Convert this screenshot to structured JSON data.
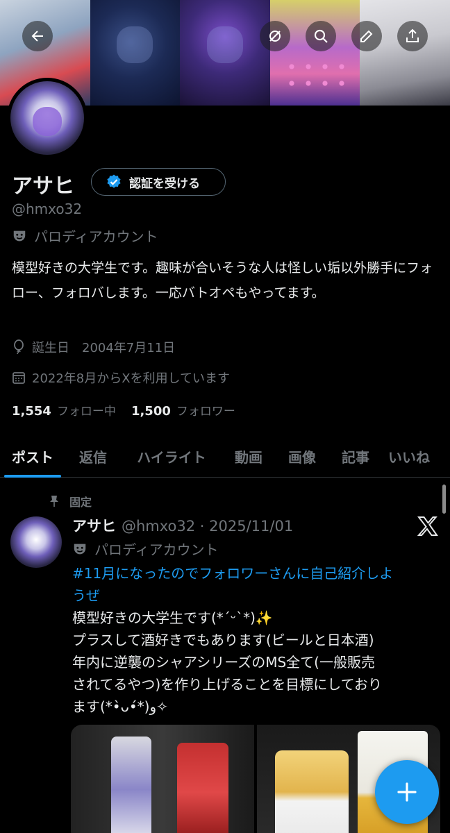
{
  "profile": {
    "name": "アサヒ",
    "verify_label": "認証を受ける",
    "handle": "@hmxo32",
    "parody_label": "パロディアカウント",
    "bio": "模型好きの大学生です。趣味が合いそうな人は怪しい垢以外勝手にフォロー、フォロバします。一応バトオペもやってます。",
    "birthday_label": "誕生日　2004年7月11日",
    "joined_label": "2022年8月からXを利用しています",
    "following_count": "1,554",
    "following_label": "フォロー中",
    "followers_count": "1,500",
    "followers_label": "フォロワー"
  },
  "tabs": [
    "ポスト",
    "返信",
    "ハイライト",
    "動画",
    "画像",
    "記事",
    "いいね"
  ],
  "active_tab": "ポスト",
  "tweet": {
    "pinned_label": "固定",
    "name": "アサヒ",
    "handle_date": "@hmxo32 · 2025/11/01",
    "parody_label": "パロディアカウント",
    "hashtag_line1": "#11月になったのでフォロワーさんに自己紹介しよ",
    "hashtag_line2": "うぜ",
    "body_lines": [
      "模型好きの大学生です(*ˊᵕˋ*)✨",
      "プラスして酒好きでもあります(ビールと日本酒)",
      "年内に逆襲のシャアシリーズのMS全て(一般販売",
      "されてるやつ)を作り上げることを目標にしており",
      "ます(*•̀ᴗ•́*)و✧"
    ]
  },
  "icons": {
    "back": "arrow-left-icon",
    "grok": "grok-icon",
    "search": "search-icon",
    "edit": "edit-icon",
    "share": "share-icon",
    "verified": "verified-badge-icon",
    "parody": "parody-mask-icon",
    "birthday": "balloon-icon",
    "calendar": "calendar-icon",
    "pin": "pin-icon",
    "x": "x-logo-icon",
    "compose": "plus-icon"
  },
  "colors": {
    "accent": "#1d9bf0",
    "background": "#000000",
    "text": "#e7e9ea",
    "muted": "#71767b"
  }
}
